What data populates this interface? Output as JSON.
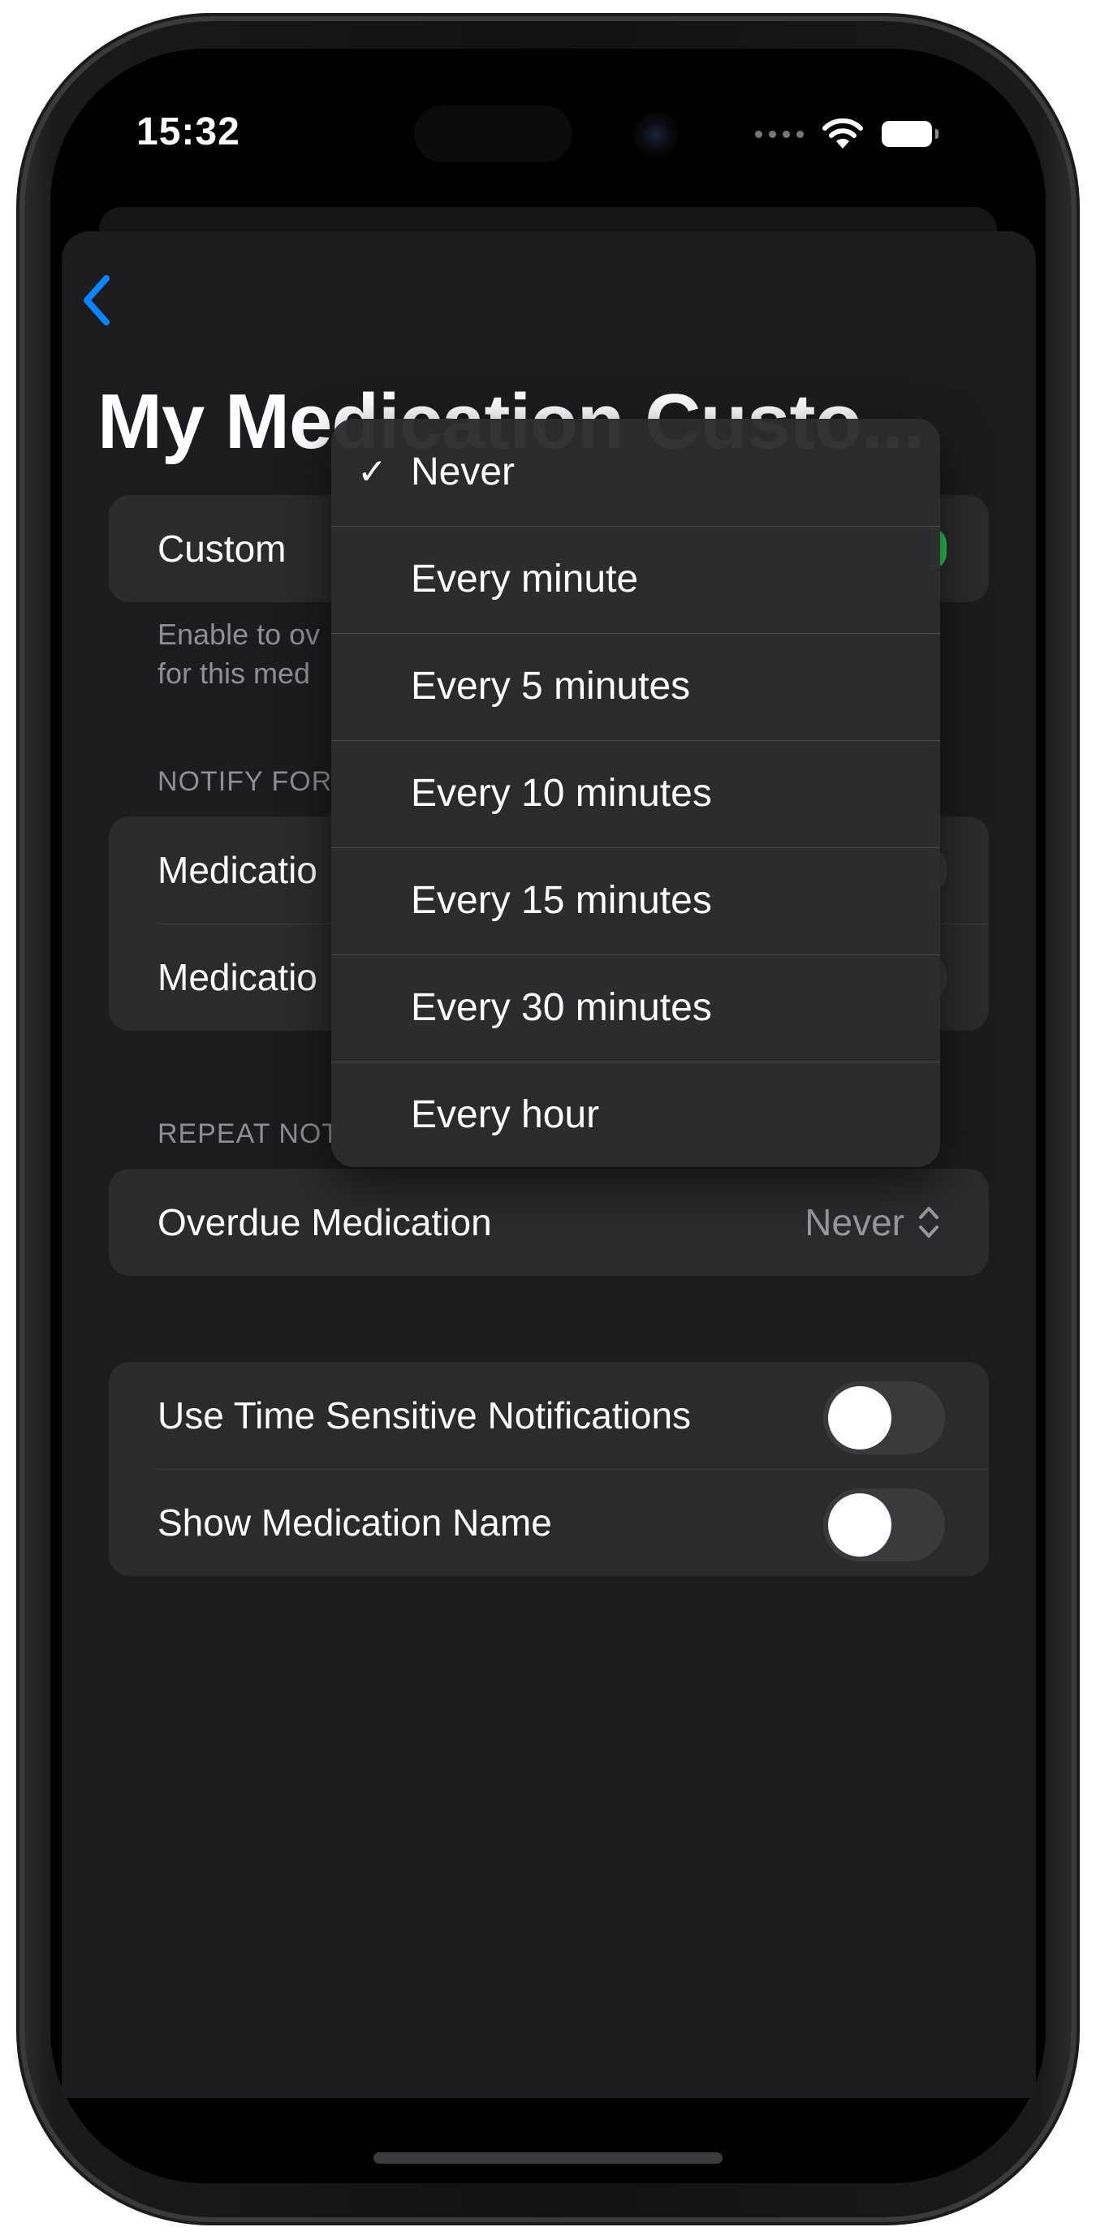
{
  "status_bar": {
    "time": "15:32"
  },
  "nav": {
    "back_icon": "chevron-left-icon",
    "accent_color": "#0a84ff"
  },
  "page": {
    "title": "My Medication Custo..."
  },
  "custom_group": {
    "label": "Custom",
    "toggle_on": true,
    "footer_line1": "Enable to ov",
    "footer_line2": "for this med"
  },
  "notify_section": {
    "header": "NOTIFY FOR",
    "rows": [
      {
        "label": "Medicatio"
      },
      {
        "label": "Medicatio"
      }
    ]
  },
  "repeat_section": {
    "header": "REPEAT NOT",
    "row_label": "Overdue Medication",
    "row_value": "Never"
  },
  "options_group": {
    "rows": [
      {
        "label": "Use Time Sensitive Notifications",
        "on": false
      },
      {
        "label": "Show Medication Name",
        "on": false
      }
    ]
  },
  "dropdown": {
    "selected": "Never",
    "checkmark": "✓",
    "items": [
      {
        "label": "Never"
      },
      {
        "label": "Every minute"
      },
      {
        "label": "Every 5 minutes"
      },
      {
        "label": "Every 10 minutes"
      },
      {
        "label": "Every 15 minutes"
      },
      {
        "label": "Every 30 minutes"
      },
      {
        "label": "Every hour"
      }
    ]
  }
}
